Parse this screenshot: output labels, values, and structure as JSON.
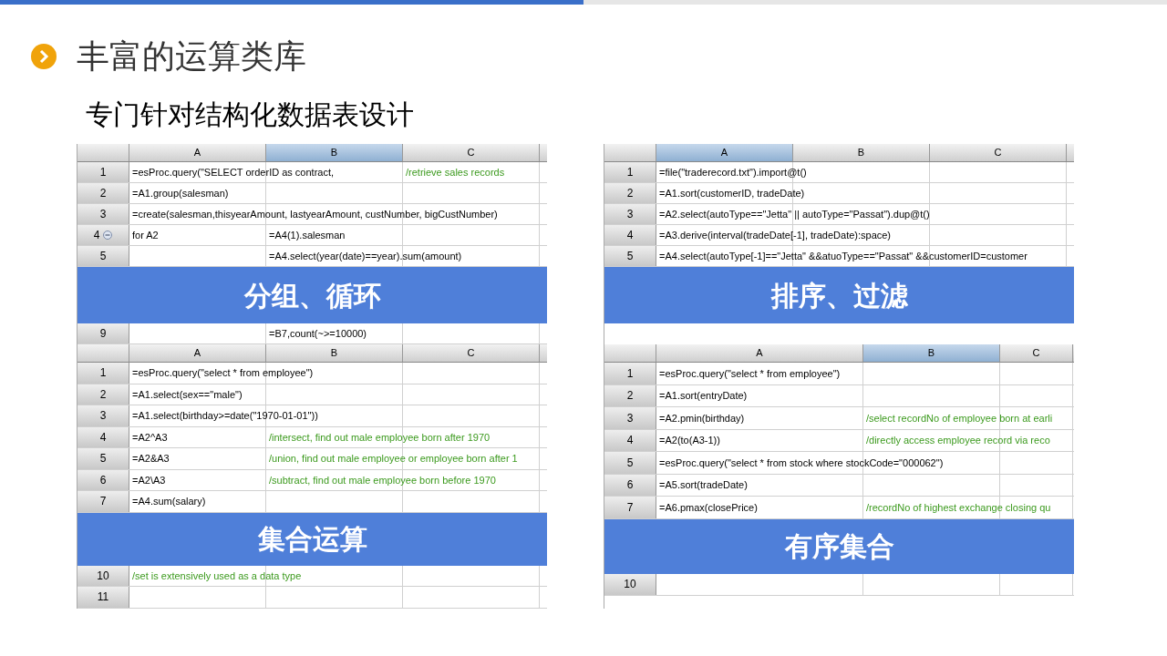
{
  "slide": {
    "title": "丰富的运算类库",
    "subtitle": "专门针对结构化数据表设计"
  },
  "panels": [
    {
      "columns": [
        {
          "label": "A",
          "selected": false
        },
        {
          "label": "B",
          "selected": true
        },
        {
          "label": "C",
          "selected": false
        }
      ],
      "rows_above": [
        {
          "number": "1",
          "cells": [
            {
              "kind": "formula",
              "text": "=esProc.query(\"SELECT orderID as contract,"
            },
            {
              "kind": "empty"
            },
            {
              "kind": "comment",
              "text": "/retrieve sales records"
            }
          ]
        },
        {
          "number": "2",
          "cells": [
            {
              "kind": "formula",
              "text": "=A1.group(salesman)"
            },
            {
              "kind": "empty"
            },
            {
              "kind": "empty"
            }
          ]
        },
        {
          "number": "3",
          "cells": [
            {
              "kind": "formula",
              "text": "=create(salesman,thisyearAmount, lastyearAmount, custNumber, bigCustNumber)"
            },
            {
              "kind": "empty"
            },
            {
              "kind": "empty"
            }
          ]
        },
        {
          "number": "4",
          "expanded": true,
          "cells": [
            {
              "kind": "formula",
              "text": "for A2"
            },
            {
              "kind": "formula",
              "text": "=A4(1).salesman"
            },
            {
              "kind": "empty"
            }
          ]
        },
        {
          "number": "5",
          "cells": [
            {
              "kind": "empty"
            },
            {
              "kind": "formula",
              "text": "=A4.select(year(date)==year).sum(amount)"
            },
            {
              "kind": "empty"
            }
          ]
        }
      ],
      "banner": {
        "text": "分组、循环"
      },
      "rows_below": [
        {
          "number": "9",
          "cells": [
            {
              "kind": "empty"
            },
            {
              "kind": "formula",
              "text": "=B7,count(~>=10000)"
            },
            {
              "kind": "empty"
            }
          ]
        }
      ]
    },
    {
      "columns": [
        {
          "label": "A",
          "selected": true
        },
        {
          "label": "B",
          "selected": false
        },
        {
          "label": "C",
          "selected": false
        }
      ],
      "rows_above": [
        {
          "number": "1",
          "cells": [
            {
              "kind": "formula",
              "text": "=file(\"traderecord.txt\").import@t()"
            },
            {
              "kind": "empty"
            },
            {
              "kind": "empty"
            }
          ]
        },
        {
          "number": "2",
          "cells": [
            {
              "kind": "formula",
              "text": "=A1.sort(customerID, tradeDate)"
            },
            {
              "kind": "empty"
            },
            {
              "kind": "empty"
            }
          ]
        },
        {
          "number": "3",
          "cells": [
            {
              "kind": "formula",
              "text": "=A2.select(autoType==\"Jetta\" || autoType=\"Passat\").dup@t()"
            },
            {
              "kind": "empty"
            },
            {
              "kind": "empty"
            }
          ]
        },
        {
          "number": "4",
          "cells": [
            {
              "kind": "formula",
              "text": "=A3.derive(interval(tradeDate[-1], tradeDate):space)"
            },
            {
              "kind": "empty"
            },
            {
              "kind": "empty"
            }
          ]
        },
        {
          "number": "5",
          "cells": [
            {
              "kind": "formula",
              "text": "=A4.select(autoType[-1]==\"Jetta\" &&atuoType==\"Passat\" &&customerID=customer"
            },
            {
              "kind": "empty"
            },
            {
              "kind": "empty"
            }
          ]
        }
      ],
      "banner": {
        "text": "排序、过滤"
      }
    },
    {
      "columns": [
        {
          "label": "A",
          "selected": false
        },
        {
          "label": "B",
          "selected": false
        },
        {
          "label": "C",
          "selected": false
        }
      ],
      "rows_above": [
        {
          "number": "1",
          "cells": [
            {
              "kind": "formula",
              "text": "=esProc.query(\"select * from employee\")"
            },
            {
              "kind": "empty"
            },
            {
              "kind": "empty"
            }
          ]
        },
        {
          "number": "2",
          "cells": [
            {
              "kind": "formula",
              "text": "=A1.select(sex==\"male\")"
            },
            {
              "kind": "empty"
            },
            {
              "kind": "empty"
            }
          ]
        },
        {
          "number": "3",
          "cells": [
            {
              "kind": "formula",
              "text": "=A1.select(birthday>=date(\"1970-01-01\"))"
            },
            {
              "kind": "empty"
            },
            {
              "kind": "empty"
            }
          ]
        },
        {
          "number": "4",
          "cells": [
            {
              "kind": "formula",
              "text": "=A2^A3"
            },
            {
              "kind": "comment",
              "text": "/intersect, find out male employee born after 1970"
            },
            {
              "kind": "empty"
            }
          ]
        },
        {
          "number": "5",
          "cells": [
            {
              "kind": "formula",
              "text": "=A2&A3"
            },
            {
              "kind": "comment",
              "text": "/union, find out  male employee or employee born after 1"
            },
            {
              "kind": "empty"
            }
          ]
        },
        {
          "number": "6",
          "cells": [
            {
              "kind": "formula",
              "text": "=A2\\A3"
            },
            {
              "kind": "comment",
              "text": "/subtract, find out male employee born before 1970"
            },
            {
              "kind": "empty"
            }
          ]
        },
        {
          "number": "7",
          "cells": [
            {
              "kind": "formula",
              "text": "=A4.sum(salary)"
            },
            {
              "kind": "empty"
            },
            {
              "kind": "empty"
            }
          ]
        }
      ],
      "banner": {
        "text": "集合运算"
      },
      "rows_below": [
        {
          "number": "10",
          "cells": [
            {
              "kind": "comment",
              "text": "/set is extensively used as a data type"
            },
            {
              "kind": "empty"
            },
            {
              "kind": "empty"
            }
          ]
        },
        {
          "number": "11",
          "cells": [
            {
              "kind": "empty"
            },
            {
              "kind": "empty"
            },
            {
              "kind": "empty"
            }
          ]
        }
      ]
    },
    {
      "columns": [
        {
          "label": "A",
          "selected": false
        },
        {
          "label": "B",
          "selected": true
        },
        {
          "label": "C",
          "selected": false
        }
      ],
      "rows_above": [
        {
          "number": "1",
          "cells": [
            {
              "kind": "formula",
              "text": "=esProc.query(\"select * from employee\")"
            },
            {
              "kind": "empty"
            },
            {
              "kind": "empty"
            }
          ]
        },
        {
          "number": "2",
          "cells": [
            {
              "kind": "formula",
              "text": "=A1.sort(entryDate)"
            },
            {
              "kind": "empty"
            },
            {
              "kind": "empty"
            }
          ]
        },
        {
          "number": "3",
          "cells": [
            {
              "kind": "formula",
              "text": "=A2.pmin(birthday)"
            },
            {
              "kind": "comment",
              "text": "/select recordNo of employee born at earli"
            },
            {
              "kind": "empty"
            }
          ]
        },
        {
          "number": "4",
          "cells": [
            {
              "kind": "formula",
              "text": "=A2(to(A3-1))"
            },
            {
              "kind": "comment",
              "text": "/directly access employee record via reco"
            },
            {
              "kind": "empty"
            }
          ]
        },
        {
          "number": "5",
          "cells": [
            {
              "kind": "formula",
              "text": "=esProc.query(\"select * from stock where stockCode=\"000062\")"
            },
            {
              "kind": "empty"
            },
            {
              "kind": "empty"
            }
          ]
        },
        {
          "number": "6",
          "cells": [
            {
              "kind": "formula",
              "text": "=A5.sort(tradeDate)"
            },
            {
              "kind": "empty"
            },
            {
              "kind": "empty"
            }
          ]
        },
        {
          "number": "7",
          "cells": [
            {
              "kind": "formula",
              "text": "=A6.pmax(closePrice)"
            },
            {
              "kind": "comment",
              "text": "/recordNo of highest exchange closing qu"
            },
            {
              "kind": "empty"
            }
          ]
        }
      ],
      "banner": {
        "text": "有序集合"
      },
      "rows_below": [
        {
          "number": "10",
          "cells": [
            {
              "kind": "empty"
            },
            {
              "kind": "empty"
            },
            {
              "kind": "empty"
            }
          ]
        }
      ]
    }
  ]
}
